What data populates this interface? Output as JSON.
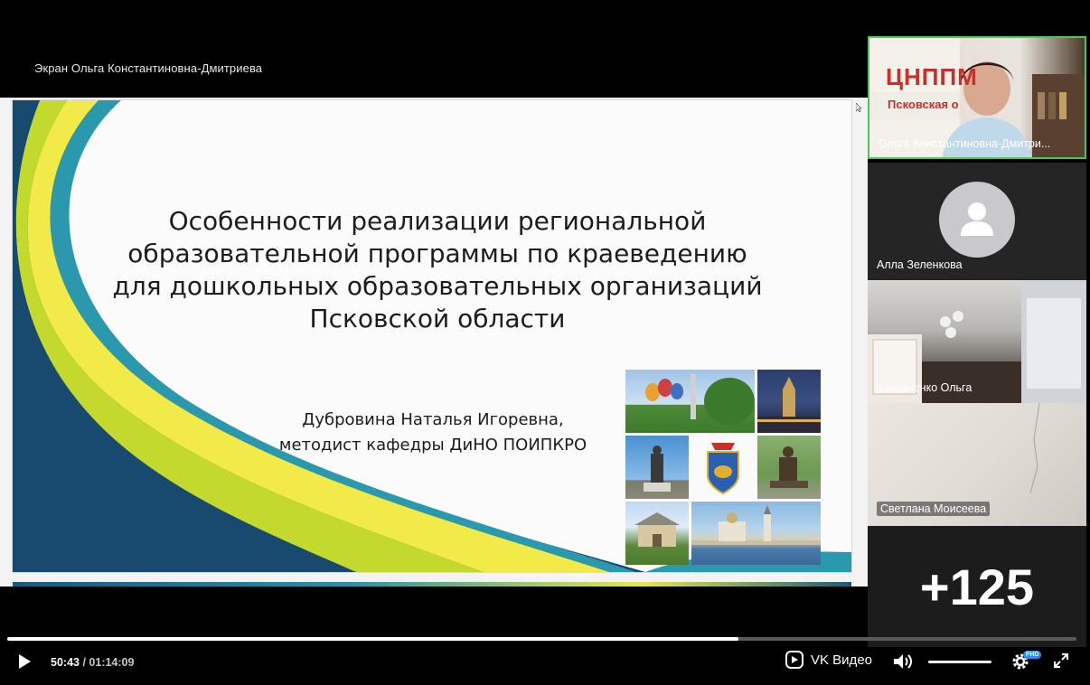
{
  "screen_label": "Экран Ольга Константиновна-Дмитриева",
  "slide": {
    "title_lines": [
      "Особенности реализации региональной",
      "образовательной программы по краеведению",
      "для дошкольных образовательных организаций",
      "Псковской области"
    ],
    "author_lines": [
      "Дубровина Наталья Игоревна,",
      "методист кафедры ДиНО ПОИПКРО"
    ]
  },
  "participants": [
    {
      "name": "Ольга Константиновна-Дмитри...",
      "active": true,
      "type": "video"
    },
    {
      "name": "Алла Зеленкова",
      "active": false,
      "type": "avatar"
    },
    {
      "name": "Захарченко Ольга",
      "active": false,
      "type": "video"
    },
    {
      "name": "Светлана Моисеева",
      "active": false,
      "type": "video"
    }
  ],
  "webcam_sign": {
    "line1": "ЦНППМ",
    "line2": "Псковская о"
  },
  "more_participants": "+125",
  "player": {
    "current_time": "50:43",
    "total_time": "/ 01:14:09",
    "progress_fraction": 0.684,
    "brand_label": "VK Видео",
    "quality_badge": "FHD"
  },
  "colors": {
    "active_border": "#52c25a",
    "accent_blue": "#2b8cf0"
  }
}
